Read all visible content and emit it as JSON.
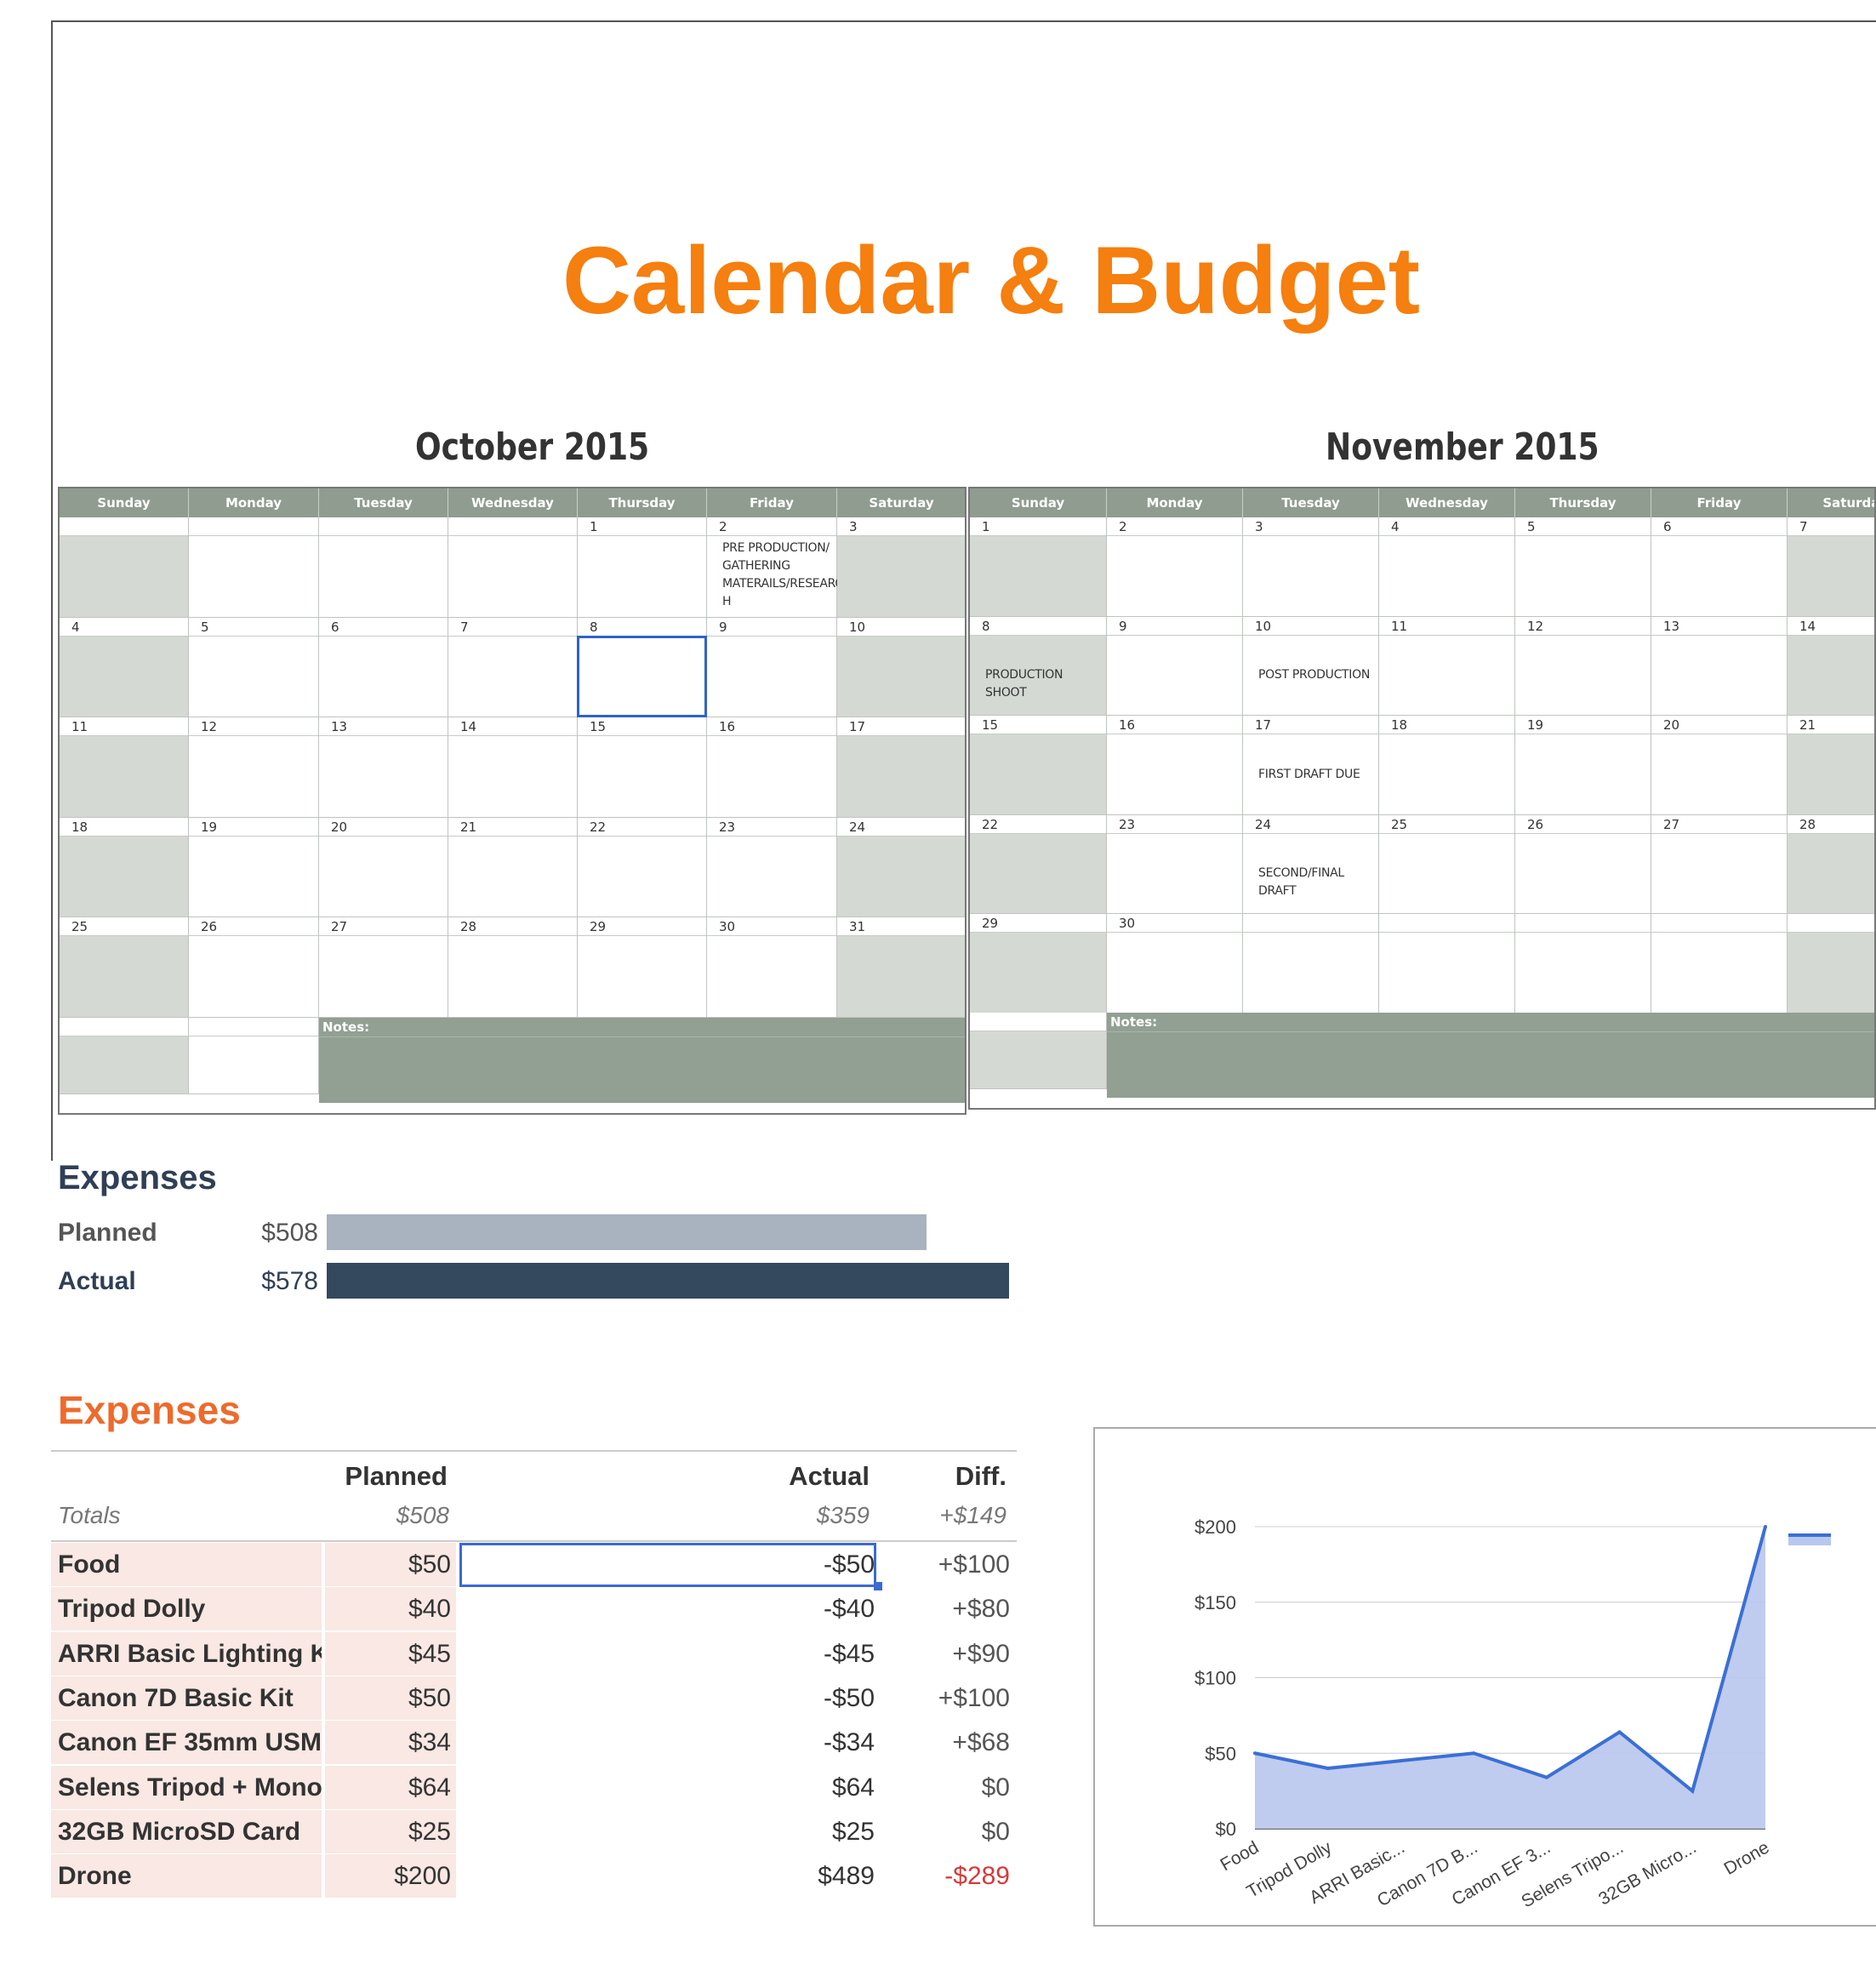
{
  "title": "Calendar & Budget",
  "weekdays": [
    "Sunday",
    "Monday",
    "Tuesday",
    "Wednesday",
    "Thursday",
    "Friday",
    "Saturday"
  ],
  "october": {
    "title": "October 2015",
    "weeks": [
      [
        "",
        "",
        "",
        "",
        "1",
        "2",
        "3"
      ],
      [
        "4",
        "5",
        "6",
        "7",
        "8",
        "9",
        "10"
      ],
      [
        "11",
        "12",
        "13",
        "14",
        "15",
        "16",
        "17"
      ],
      [
        "18",
        "19",
        "20",
        "21",
        "22",
        "23",
        "24"
      ],
      [
        "25",
        "26",
        "27",
        "28",
        "29",
        "30",
        "31"
      ]
    ],
    "events": [
      {
        "week": 0,
        "day": 5,
        "text": "PRE PRODUCTION/ GATHERING MATERAILS/RESEARC H"
      }
    ],
    "notes_label": "Notes:"
  },
  "november": {
    "title": "November 2015",
    "weeks": [
      [
        "1",
        "2",
        "3",
        "4",
        "5",
        "6",
        "7"
      ],
      [
        "8",
        "9",
        "10",
        "11",
        "12",
        "13",
        "14"
      ],
      [
        "15",
        "16",
        "17",
        "18",
        "19",
        "20",
        "21"
      ],
      [
        "22",
        "23",
        "24",
        "25",
        "26",
        "27",
        "28"
      ],
      [
        "29",
        "30",
        "",
        "",
        "",
        "",
        ""
      ]
    ],
    "events": [
      {
        "week": 1,
        "day": 0,
        "text": "PRODUCTION SHOOT"
      },
      {
        "week": 1,
        "day": 2,
        "text": "POST PRODUCTION"
      },
      {
        "week": 2,
        "day": 2,
        "text": "FIRST DRAFT DUE"
      },
      {
        "week": 3,
        "day": 2,
        "text": "SECOND/FINAL DRAFT"
      }
    ],
    "notes_label": "Notes:"
  },
  "summary": {
    "title": "Expenses",
    "planned": {
      "label": "Planned",
      "value": "$508",
      "amount": 508,
      "color": "#a9b3bf"
    },
    "actual": {
      "label": "Actual",
      "value": "$578",
      "amount": 578,
      "color": "#34495e"
    }
  },
  "expenses": {
    "title": "Expenses",
    "headers": {
      "planned": "Planned",
      "actual": "Actual",
      "diff": "Diff."
    },
    "totals": {
      "label": "Totals",
      "planned": "$508",
      "actual": "$359",
      "diff": "+$149"
    },
    "rows": [
      {
        "name": "Food",
        "planned": "$50",
        "actual": "-$50",
        "diff": "+$100"
      },
      {
        "name": "Tripod Dolly",
        "planned": "$40",
        "actual": "-$40",
        "diff": "+$80"
      },
      {
        "name": "ARRI Basic Lighting K",
        "planned": "$45",
        "actual": "-$45",
        "diff": "+$90"
      },
      {
        "name": "Canon 7D Basic Kit",
        "planned": "$50",
        "actual": "-$50",
        "diff": "+$100"
      },
      {
        "name": "Canon EF 35mm USM",
        "planned": "$34",
        "actual": "-$34",
        "diff": "+$68"
      },
      {
        "name": "Selens Tripod + Monoj",
        "planned": "$64",
        "actual": "$64",
        "diff": "$0"
      },
      {
        "name": "32GB MicroSD Card",
        "planned": "$25",
        "actual": "$25",
        "diff": "$0"
      },
      {
        "name": "Drone",
        "planned": "$200",
        "actual": "$489",
        "diff": "-$289"
      }
    ]
  },
  "colors": {
    "accent": "#f57f0f",
    "header_green": "#8f9c8f",
    "weekend": "#d4d9d3",
    "chart_line": "#3b6fd6",
    "chart_fill": "#b8c7ee",
    "negative": "#d63a3a"
  },
  "chart_data": {
    "type": "area",
    "categories": [
      "Food",
      "Tripod Dolly",
      "ARRI Basic...",
      "Canon 7D B...",
      "Canon EF 3...",
      "Selens Tripo...",
      "32GB Micro...",
      "Drone"
    ],
    "series": [
      {
        "values": [
          50,
          40,
          45,
          50,
          34,
          64,
          25,
          200
        ]
      }
    ],
    "yticks": [
      "$0",
      "$50",
      "$100",
      "$150",
      "$200"
    ],
    "ylim": [
      0,
      200
    ],
    "grid": true,
    "legend": "right"
  }
}
